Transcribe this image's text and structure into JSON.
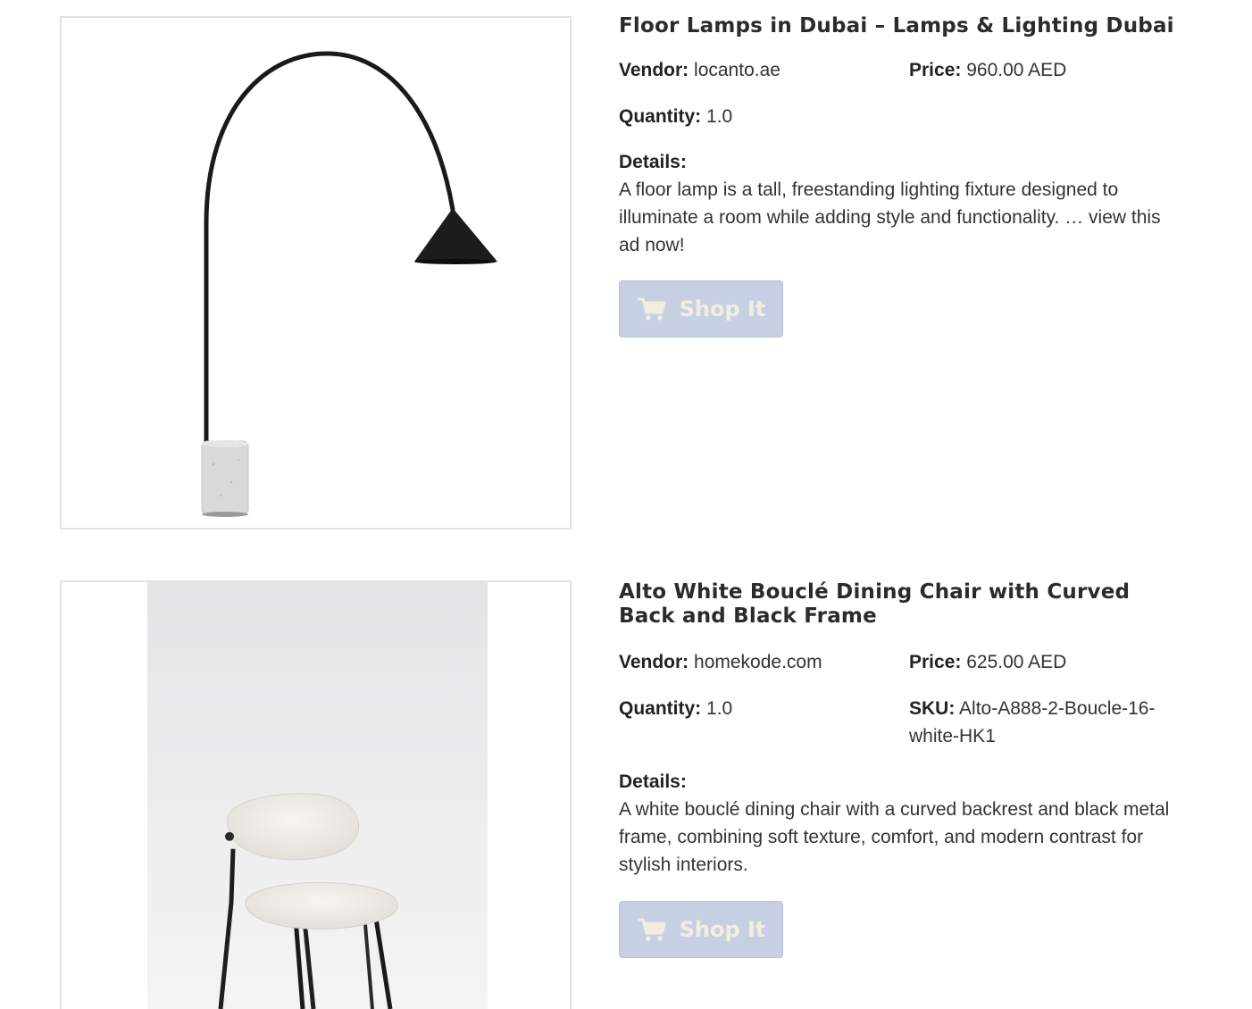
{
  "products": [
    {
      "title": "Floor Lamps in Dubai – Lamps & Lighting Dubai",
      "vendor_label": "Vendor:",
      "vendor": "locanto.ae",
      "price_label": "Price:",
      "price": "960.00 AED",
      "quantity_label": "Quantity:",
      "quantity": "1.0",
      "details_label": "Details:",
      "details": "A floor lamp is a tall, freestanding lighting fixture designed to illuminate a room while adding style and functionality. … view this ad now!",
      "button_label": "Shop It",
      "button_icon": "cart-icon",
      "image": "floor-lamp-image"
    },
    {
      "title": "Alto White Bouclé Dining Chair with Curved Back and Black Frame",
      "vendor_label": "Vendor:",
      "vendor": "homekode.com",
      "price_label": "Price:",
      "price": "625.00 AED",
      "quantity_label": "Quantity:",
      "quantity": "1.0",
      "sku_label": "SKU:",
      "sku": "Alto-A888-2-Boucle-16-white-HK1",
      "details_label": "Details:",
      "details": "A white bouclé dining chair with a curved backrest and black metal frame, combining soft texture, comfort, and modern contrast for stylish interiors.",
      "button_label": "Shop It",
      "button_icon": "cart-icon",
      "image": "dining-chair-image"
    }
  ],
  "colors": {
    "button_bg": "#c7d0e3",
    "button_text": "#f2eedf",
    "frame_border": "#e2e2e2"
  }
}
